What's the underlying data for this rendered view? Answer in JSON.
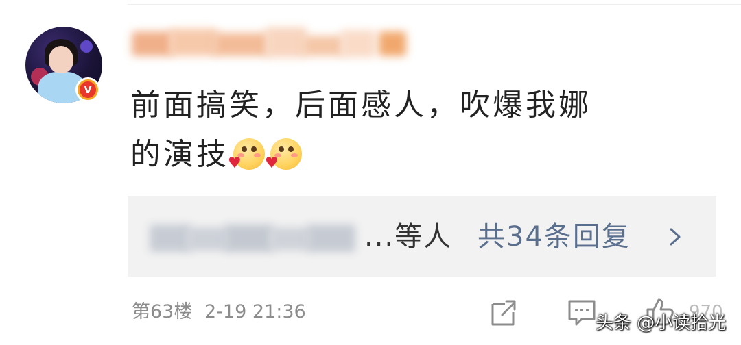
{
  "comment": {
    "line1": "前面搞笑，后面感人，吹爆我娜",
    "line2": "的演技",
    "emojis": [
      "heart-eyes-emoji",
      "heart-eyes-emoji"
    ]
  },
  "avatar": {
    "verified_badge": "V",
    "badge_color": "#f6a623"
  },
  "replies": {
    "suffix": "...等人",
    "count_label": "共34条回复",
    "chevron_icon": "chevron-right-icon"
  },
  "footer": {
    "floor": "第63楼",
    "timestamp": "2-19 21:36",
    "likes": "970",
    "icons": [
      "share-icon",
      "comment-icon",
      "like-icon"
    ]
  },
  "watermark": "头条 @小读拾光",
  "colors": {
    "text": "#222222",
    "link": "#5a6f8e",
    "meta": "#8c8c8c",
    "reply_bg": "#f2f2f2"
  }
}
